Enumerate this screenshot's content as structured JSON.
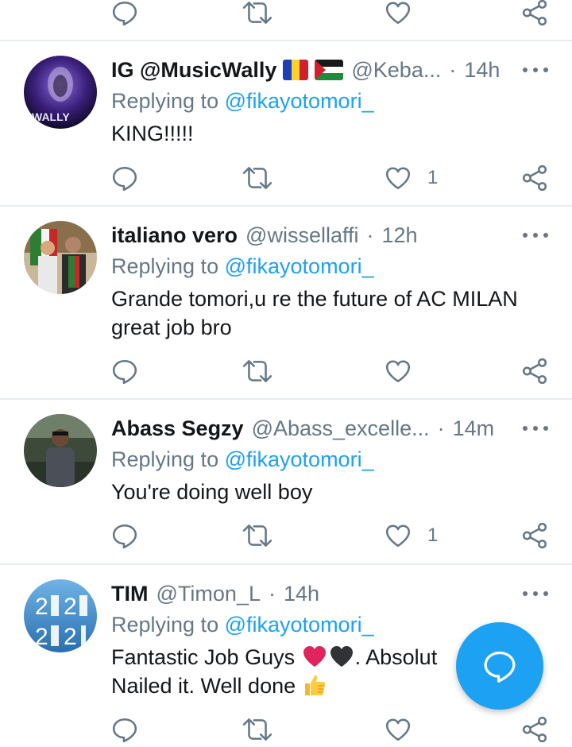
{
  "replying_label": "Replying to",
  "tweets": [
    {
      "name": "IG @MusicWally",
      "handle": "@Keba...",
      "time": "14h",
      "reply_to": "@fikayotomori_",
      "text_lines": [
        "KING!!!!!"
      ],
      "like_count": "1",
      "avatar_text": "WALLY",
      "flags": [
        "romania-flag",
        "palestine-flag"
      ]
    },
    {
      "name": "italiano vero",
      "handle": "@wissellaffi",
      "time": "12h",
      "reply_to": "@fikayotomori_",
      "text_lines": [
        "Grande tomori,u re the future of AC MILAN",
        "great job bro"
      ],
      "like_count": ""
    },
    {
      "name": "Abass Segzy",
      "handle": "@Abass_excelle...",
      "time": "14m",
      "reply_to": "@fikayotomori_",
      "text_lines": [
        "You're doing well boy"
      ],
      "like_count": "1"
    },
    {
      "name": "TIM",
      "handle": "@Timon_L",
      "time": "14h",
      "reply_to": "@fikayotomori_",
      "text_line1_a": "Fantastic Job Guys",
      "text_line1_b": ". Absolut",
      "text_line2": "Nailed it. Well done",
      "avatar_text_top": "2",
      "avatar_text_bottom": "2"
    }
  ],
  "colors": {
    "accent": "#1da1f2",
    "secondary_text": "#657786",
    "primary_text": "#14171a",
    "divider": "#e6ecf0"
  },
  "icons": [
    "reply-icon",
    "retweet-icon",
    "like-icon",
    "share-icon",
    "more-icon",
    "compose-reply-icon",
    "red-heart-icon",
    "black-heart-icon",
    "thumbs-up-icon"
  ]
}
